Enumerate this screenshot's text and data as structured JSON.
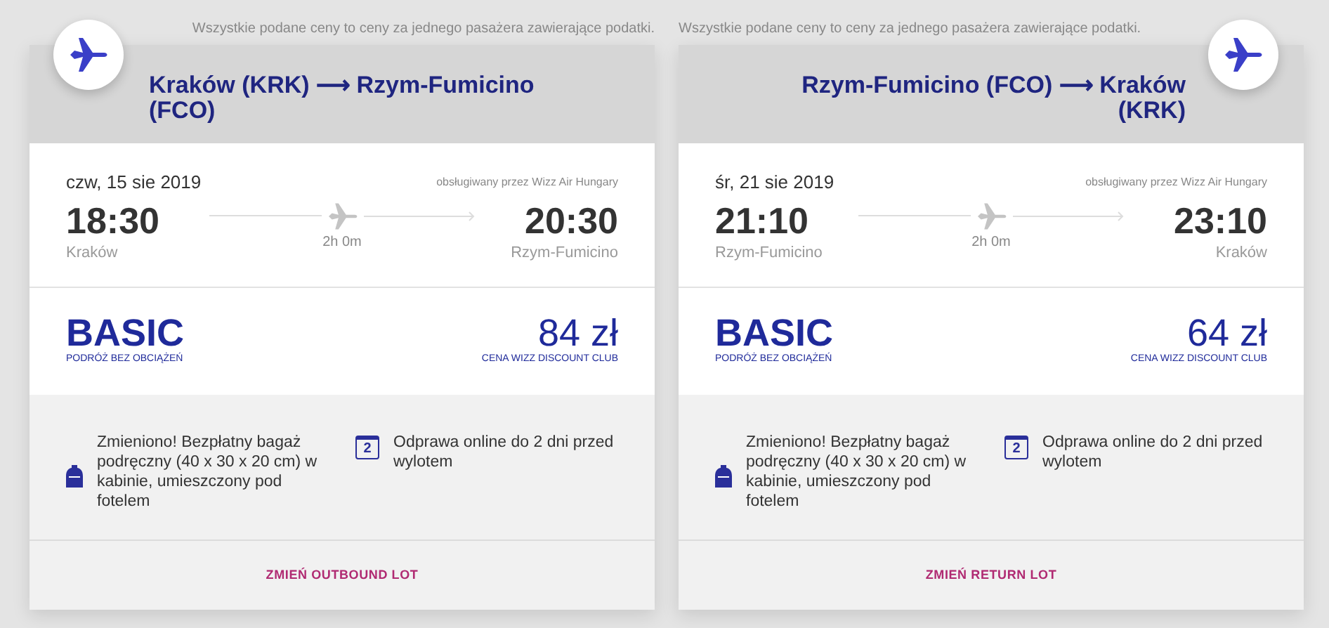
{
  "flights": [
    {
      "kind": "outbound",
      "notice": "Wszystkie podane ceny to ceny za jednego pasażera zawierające podatki.",
      "route": "Kraków (KRK) ⟶ Rzym-Fumicino (FCO)",
      "date": "czw, 15 sie 2019",
      "operator": "obsługiwany przez Wizz Air Hungary",
      "depart_time": "18:30",
      "depart_city": "Kraków",
      "duration": "2h 0m",
      "arrive_time": "20:30",
      "arrive_city": "Rzym-Fumicino",
      "fare": "BASIC",
      "fare_note": "PODRÓŻ BEZ OBCIĄŻEŃ",
      "price": "84 zł",
      "price_note": "CENA WIZZ DISCOUNT CLUB",
      "features": [
        {
          "kind": "bag",
          "text": "Zmieniono! Bezpłatny bagaż podręczny (40 x 30 x 20 cm) w kabinie, umieszczony pod fotelem"
        },
        {
          "kind": "calendar",
          "text": "Odprawa online do 2 dni przed wylotem",
          "icon_text": "2"
        }
      ],
      "change_button": "ZMIEŃ OUTBOUND LOT"
    },
    {
      "kind": "return",
      "notice": "Wszystkie podane ceny to ceny za jednego pasażera zawierające podatki.",
      "route": "Rzym-Fumicino (FCO) ⟶ Kraków (KRK)",
      "date": "śr, 21 sie 2019",
      "operator": "obsługiwany przez Wizz Air Hungary",
      "depart_time": "21:10",
      "depart_city": "Rzym-Fumicino",
      "duration": "2h 0m",
      "arrive_time": "23:10",
      "arrive_city": "Kraków",
      "fare": "BASIC",
      "fare_note": "PODRÓŻ BEZ OBCIĄŻEŃ",
      "price": "64 zł",
      "price_note": "CENA WIZZ DISCOUNT CLUB",
      "features": [
        {
          "kind": "bag",
          "text": "Zmieniono! Bezpłatny bagaż podręczny (40 x 30 x 20 cm) w kabinie, umieszczony pod fotelem"
        },
        {
          "kind": "calendar",
          "text": "Odprawa online do 2 dni przed wylotem",
          "icon_text": "2"
        }
      ],
      "change_button": "ZMIEŃ RETURN LOT"
    }
  ]
}
